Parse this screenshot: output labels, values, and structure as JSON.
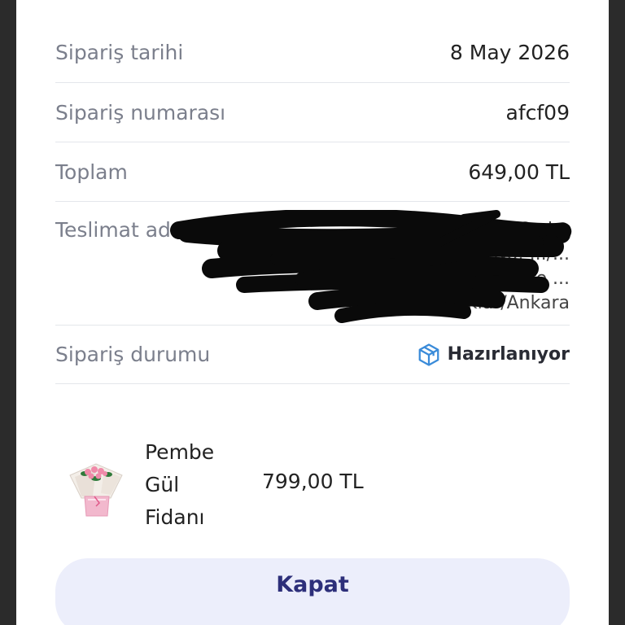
{
  "order": {
    "rows": [
      {
        "label": "Sipariş tarihi",
        "value": "8 May 2026"
      },
      {
        "label": "Sipariş numarası",
        "value": "afcf09"
      },
      {
        "label": "Toplam",
        "value": "649,00 TL"
      },
      {
        "label": "Teslimat adresi",
        "lines": [
          "Mah... Cad...",
          "No: .../...",
          "... Daire ...",
          "...11 Pursaklar/Ankara"
        ]
      },
      {
        "label": "Sipariş durumu",
        "status": "Hazırlanıyor",
        "icon": "package-box-icon",
        "icon_color": "#3a8bd9"
      }
    ]
  },
  "product": {
    "name_lines": [
      "Pembe",
      "Gül",
      "Fidanı"
    ],
    "price": "799,00 TL"
  },
  "actions": {
    "close_label": "Kapat"
  },
  "colors": {
    "accent": "#2d2f7a",
    "button_bg": "#eceefb",
    "redaction": "#0a0a0a"
  }
}
